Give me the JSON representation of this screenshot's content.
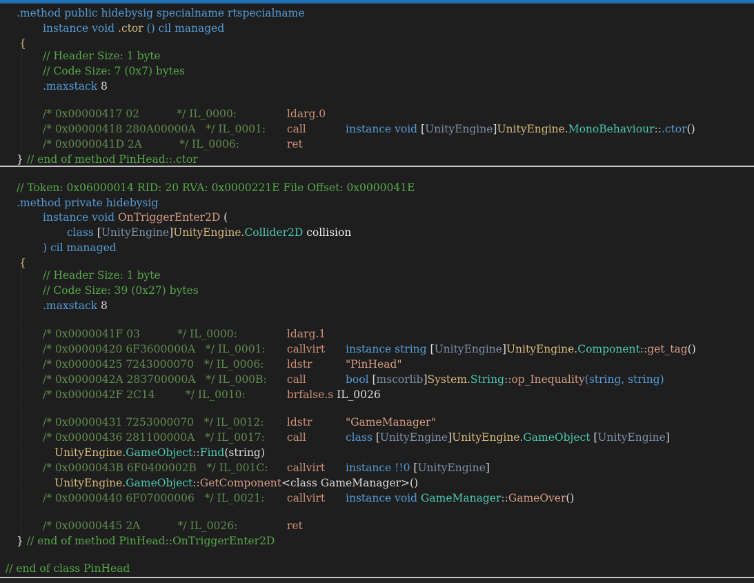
{
  "block1": {
    "l1a": ".method",
    "l1b": " public hidebysig specialname rtspecialname",
    "l2a": "instance",
    "l2b": " void ",
    "l2c": ".ctor",
    "l2d": " () cil managed",
    "brace_open": "{",
    "h1": "// Header Size: 1 byte",
    "h2": "// Code Size: 7 (0x7) bytes",
    "ms_a": ".maxstack",
    "ms_b": " 8",
    "r1_cmt": "/* 0x00000417 02           */",
    "r1_lbl": " IL_0000:",
    "r1_op": " ldarg.0",
    "r2_cmt": "/* 0x00000418 280A00000A   */",
    "r2_lbl": " IL_0001:",
    "r2_op": " call",
    "r2_a": "instance void ",
    "r2_b": "[",
    "r2_c": "UnityEngine",
    "r2_d": "]",
    "r2_e": "UnityEngine.",
    "r2_f": "MonoBehaviour",
    "r2_g": "::",
    "r2_h": ".ctor",
    "r2_i": "()",
    "r3_cmt": "/* 0x0000041D 2A           */",
    "r3_lbl": " IL_0006:",
    "r3_op": " ret",
    "end_a": "}",
    "end_b": " // end of method PinHead::.ctor"
  },
  "block2": {
    "token": "// Token: 0x06000014 RID: 20 RVA: 0x0000221E File Offset: 0x0000041E",
    "l1a": ".method",
    "l1b": " private hidebysig",
    "l2a": "instance void ",
    "l2b": "OnTriggerEnter2D",
    "l2c": " (",
    "l3a": "class ",
    "l3b": "[",
    "l3c": "UnityEngine",
    "l3d": "]",
    "l3e": "UnityEngine.",
    "l3f": "Collider2D",
    "l3g": " collision",
    "l4a": ") cil managed",
    "brace_open": "{",
    "h1": "// Header Size: 1 byte",
    "h2": "// Code Size: 39 (0x27) bytes",
    "ms_a": ".maxstack",
    "ms_b": " 8",
    "r1_cmt": "/* 0x0000041F 03           */",
    "r1_lbl": " IL_0000:",
    "r1_op": " ldarg.1",
    "r2_cmt": "/* 0x00000420 6F3600000A   */",
    "r2_lbl": " IL_0001:",
    "r2_op": " callvirt",
    "r2_a": "instance string ",
    "r2_b": "[",
    "r2_c": "UnityEngine",
    "r2_d": "]",
    "r2_e": "UnityEngine.",
    "r2_f": "Component",
    "r2_g": "::",
    "r2_h": "get_tag",
    "r2_i": "()",
    "r3_cmt": "/* 0x00000425 7243000070   */",
    "r3_lbl": " IL_0006:",
    "r3_op": " ldstr",
    "r3_a": "\"PinHead\"",
    "r4_cmt": "/* 0x0000042A 283700000A   */",
    "r4_lbl": " IL_000B:",
    "r4_op": " call",
    "r4_a": "bool ",
    "r4_b": "[",
    "r4_c": "mscorlib",
    "r4_d": "]",
    "r4_e": "System.",
    "r4_f": "String",
    "r4_g": "::",
    "r4_h": "op_Inequality",
    "r4_i": "(string, string)",
    "r5_cmt": "/* 0x0000042F 2C14         */",
    "r5_lbl": " IL_0010:",
    "r5_op": " brfalse.s",
    "r5_a": " IL_0026",
    "r6_cmt": "/* 0x00000431 7253000070   */",
    "r6_lbl": " IL_0012:",
    "r6_op": " ldstr",
    "r6_a": "\"GameManager\"",
    "r7_cmt": "/* 0x00000436 281100000A   */",
    "r7_lbl": " IL_0017:",
    "r7_op": " call",
    "r7_a": "class ",
    "r7_b": "[",
    "r7_c": "UnityEngine",
    "r7_d": "]",
    "r7_e": "UnityEngine.",
    "r7_f": "GameObject",
    "r7_g": " [",
    "r7_h": "UnityEngine",
    "r7_i": "]",
    "r7w_a": "UnityEngine.",
    "r7w_b": "GameObject",
    "r7w_c": "::",
    "r7w_d": "Find",
    "r7w_e": "(string)",
    "r8_cmt": "/* 0x0000043B 6F0400002B   */",
    "r8_lbl": " IL_001C:",
    "r8_op": " callvirt",
    "r8_a": "instance !!0 ",
    "r8_b": "[",
    "r8_c": "UnityEngine",
    "r8_d": "]",
    "r8w_a": "UnityEngine.",
    "r8w_b": "GameObject",
    "r8w_c": "::",
    "r8w_d": "GetComponent",
    "r8w_e": "<class GameManager>()",
    "r9_cmt": "/* 0x00000440 6F07000006   */",
    "r9_lbl": " IL_0021:",
    "r9_op": " callvirt",
    "r9_a": "instance void ",
    "r9_b": "GameManager",
    "r9_c": "::",
    "r9_d": "GameOver",
    "r9_e": "()",
    "r10_cmt": "/* 0x00000445 2A           */",
    "r10_lbl": " IL_0026:",
    "r10_op": " ret",
    "end_a": "}",
    "end_b": " // end of method PinHead::OnTriggerEnter2D"
  },
  "end_class": "// end of class PinHead"
}
